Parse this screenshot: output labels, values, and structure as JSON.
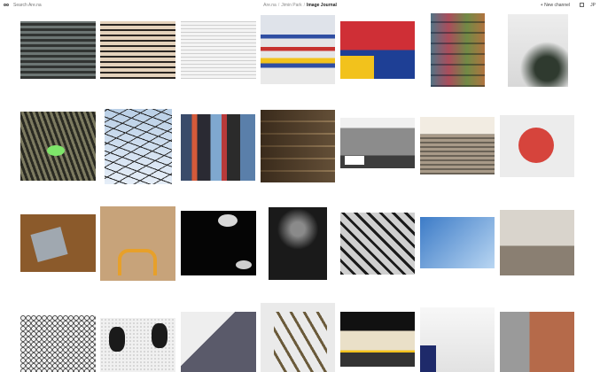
{
  "header": {
    "search_placeholder": "Search Are.na",
    "breadcrumb": [
      "Are.na",
      "Jimin Park",
      "Image Journal"
    ],
    "new_channel_label": "+ New channel",
    "user_initials": "JP"
  },
  "blocks": [
    {
      "row": 1,
      "col": 1,
      "subject": "glass office tower facade"
    },
    {
      "row": 1,
      "col": 2,
      "subject": "window blinds with warm light"
    },
    {
      "row": 1,
      "col": 3,
      "subject": "white corrugated panel wall"
    },
    {
      "row": 1,
      "col": 4,
      "subject": "striped red blue yellow panels"
    },
    {
      "row": 1,
      "col": 5,
      "subject": "red blue yellow building facade"
    },
    {
      "row": 1,
      "col": 6,
      "subject": "colorful balconies"
    },
    {
      "row": 1,
      "col": 7,
      "subject": "palm leaves against white wall"
    },
    {
      "row": 2,
      "col": 1,
      "subject": "tree roots with green light"
    },
    {
      "row": 2,
      "col": 2,
      "subject": "utility pole with wires"
    },
    {
      "row": 2,
      "col": 3,
      "subject": "dense city street signs"
    },
    {
      "row": 2,
      "col": 4,
      "subject": "old apartment buildings"
    },
    {
      "row": 2,
      "col": 5,
      "subject": "street corner with white van"
    },
    {
      "row": 2,
      "col": 6,
      "subject": "subway stairs"
    },
    {
      "row": 2,
      "col": 7,
      "subject": "red garage sign"
    },
    {
      "row": 3,
      "col": 1,
      "subject": "cd on wooden floor"
    },
    {
      "row": 3,
      "col": 2,
      "subject": "paper bag with golden arches"
    },
    {
      "row": 3,
      "col": 3,
      "subject": "lamps on black background"
    },
    {
      "row": 3,
      "col": 4,
      "subject": "dark room with window light"
    },
    {
      "row": 3,
      "col": 5,
      "subject": "glass roof structure"
    },
    {
      "row": 3,
      "col": 6,
      "subject": "glass building against sky"
    },
    {
      "row": 3,
      "col": 7,
      "subject": "city skyline with fence"
    },
    {
      "row": 4,
      "col": 1,
      "subject": "hexagon metal mesh"
    },
    {
      "row": 4,
      "col": 2,
      "subject": "feet on patterned floor"
    },
    {
      "row": 4,
      "col": 3,
      "subject": "lattice tower"
    },
    {
      "row": 4,
      "col": 4,
      "subject": "steel bridge truss"
    },
    {
      "row": 4,
      "col": 5,
      "subject": "subway platform"
    },
    {
      "row": 4,
      "col": 6,
      "subject": "white corridor with light"
    },
    {
      "row": 4,
      "col": 7,
      "subject": "terracotta building with railing"
    }
  ]
}
